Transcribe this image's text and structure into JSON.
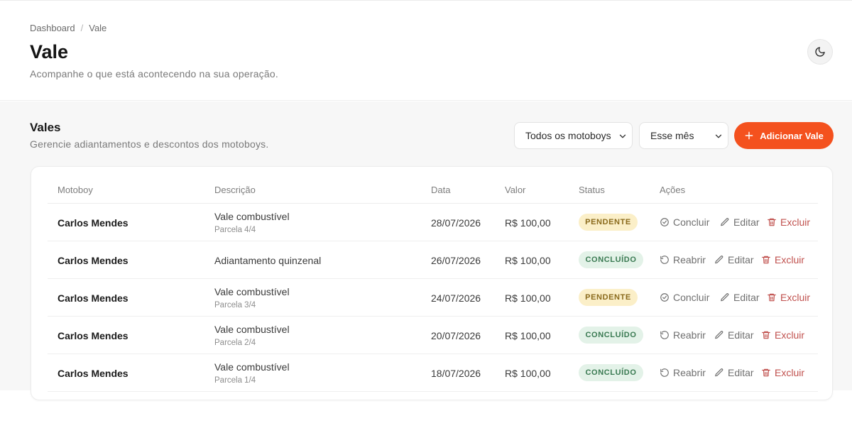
{
  "breadcrumb": {
    "root": "Dashboard",
    "separator": "/",
    "current": "Vale"
  },
  "page": {
    "title": "Vale",
    "subtitle": "Acompanhe o que está acontecendo na sua operação."
  },
  "theme_toggle": {
    "icon": "moon-icon"
  },
  "section": {
    "title": "Vales",
    "subtitle": "Gerencie adiantamentos e descontos dos motoboys."
  },
  "filters": {
    "motoboy": "Todos os motoboys",
    "period": "Esse mês"
  },
  "add_button": {
    "label": "Adicionar Vale"
  },
  "colors": {
    "accent": "#f4511e",
    "pending_bg": "#fbefc8",
    "pending_text": "#8a6a1c",
    "done_bg": "#e3f2e8",
    "done_text": "#3a7a52",
    "danger": "#c0504d"
  },
  "table": {
    "columns": [
      "Motoboy",
      "Descrição",
      "Data",
      "Valor",
      "Status",
      "Ações"
    ],
    "rows": [
      {
        "motoboy": "Carlos Mendes",
        "description": "Vale combustível",
        "installment": "Parcela 4/4",
        "date": "28/07/2026",
        "value": "R$ 100,00",
        "status": "PENDENTE",
        "primary_action": "Concluir",
        "edit": "Editar",
        "delete": "Excluir"
      },
      {
        "motoboy": "Carlos Mendes",
        "description": "Adiantamento quinzenal",
        "installment": "",
        "date": "26/07/2026",
        "value": "R$ 100,00",
        "status": "CONCLUÍDO",
        "primary_action": "Reabrir",
        "edit": "Editar",
        "delete": "Excluir"
      },
      {
        "motoboy": "Carlos Mendes",
        "description": "Vale combustível",
        "installment": "Parcela 3/4",
        "date": "24/07/2026",
        "value": "R$ 100,00",
        "status": "PENDENTE",
        "primary_action": "Concluir",
        "edit": "Editar",
        "delete": "Excluir"
      },
      {
        "motoboy": "Carlos Mendes",
        "description": "Vale combustível",
        "installment": "Parcela 2/4",
        "date": "20/07/2026",
        "value": "R$ 100,00",
        "status": "CONCLUÍDO",
        "primary_action": "Reabrir",
        "edit": "Editar",
        "delete": "Excluir"
      },
      {
        "motoboy": "Carlos Mendes",
        "description": "Vale combustível",
        "installment": "Parcela 1/4",
        "date": "18/07/2026",
        "value": "R$ 100,00",
        "status": "CONCLUÍDO",
        "primary_action": "Reabrir",
        "edit": "Editar",
        "delete": "Excluir"
      }
    ]
  }
}
